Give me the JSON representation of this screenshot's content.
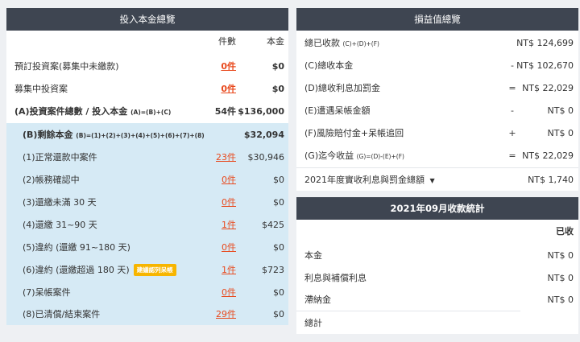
{
  "left": {
    "title": "投入本金總覽",
    "head_count": "件數",
    "head_amount": "本金",
    "rows": [
      {
        "label": "預訂投資案(募集中未繳款)",
        "count": "0件",
        "amount": "$0"
      },
      {
        "label": "募集中投資案",
        "count": "0件",
        "amount": "$0"
      },
      {
        "label": "(A)投資案件總數 / 投入本金",
        "sub": "(A)=(B)+(C)",
        "count": "54件",
        "amount": "$136,000"
      }
    ],
    "remain": {
      "label": "(B)剩餘本金",
      "sub": "(B)=(1)+(2)+(3)+(4)+(5)+(6)+(7)+(8)",
      "amount": "$32,094"
    },
    "items": [
      {
        "label": "(1)正常還款中案件",
        "count": "23件",
        "amount": "$30,946"
      },
      {
        "label": "(2)帳務確認中",
        "count": "0件",
        "amount": "$0"
      },
      {
        "label": "(3)還繳未滿 30 天",
        "count": "0件",
        "amount": "$0"
      },
      {
        "label": "(4)還繳 31~90 天",
        "count": "1件",
        "amount": "$425"
      },
      {
        "label": "(5)違約 (還繳 91~180 天)",
        "count": "0件",
        "amount": "$0"
      },
      {
        "label": "(6)違約 (還繳超過 180 天)",
        "tag": "建議認列呆帳",
        "count": "1件",
        "amount": "$723"
      },
      {
        "label": "(7)呆帳案件",
        "count": "0件",
        "amount": "$0"
      },
      {
        "label": "(8)已清償/結束案件",
        "count": "29件",
        "amount": "$0"
      }
    ]
  },
  "right": {
    "title": "損益值總覽",
    "rows": [
      {
        "label": "總已收款",
        "sub": "(C)+(D)+(F)",
        "op": "",
        "amount": "NT$ 124,699"
      },
      {
        "label": "(C)總收本金",
        "op": "-",
        "amount": "NT$ 102,670"
      },
      {
        "label": "(D)總收利息加罰金",
        "op": "=",
        "amount": "NT$ 22,029"
      },
      {
        "label": "(E)遭遇呆帳金額",
        "op": "-",
        "amount": "NT$ 0"
      },
      {
        "label": "(F)風險賠付金+呆帳追回",
        "op": "+",
        "amount": "NT$ 0"
      },
      {
        "label": "(G)迄今收益",
        "sub": "(G)=(D)-(E)+(F)",
        "op": "=",
        "amount": "NT$ 22,029"
      }
    ],
    "yearly": {
      "label": "2021年度實收利息與罰金總額",
      "amount": "NT$ 1,740"
    }
  },
  "monthly": {
    "title": "2021年09月收款統計",
    "col_received": "已收",
    "rows": [
      {
        "label": "本金",
        "amount": "NT$ 0"
      },
      {
        "label": "利息與補償利息",
        "amount": "NT$ 0"
      },
      {
        "label": "滯納金",
        "amount": "NT$ 0"
      },
      {
        "label": "總計",
        "amount": ""
      }
    ]
  },
  "colors": {
    "header": "#3e4551",
    "accent_red": "#e8491d",
    "highlight_blue": "#d6eaf5",
    "tag_yellow": "#f7b500"
  }
}
